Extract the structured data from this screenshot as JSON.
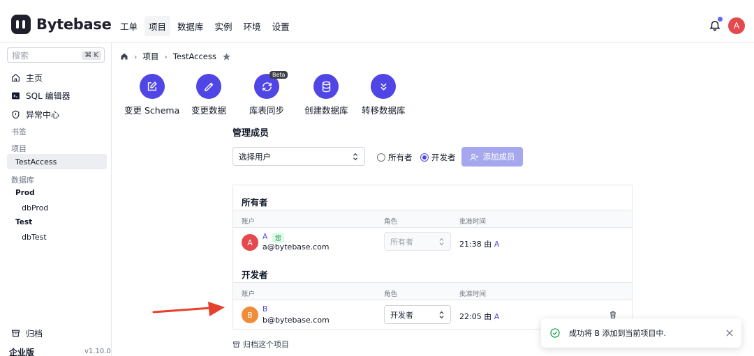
{
  "header": {
    "brand": "Bytebase",
    "nav": [
      "工单",
      "项目",
      "数据库",
      "实例",
      "环境",
      "设置"
    ],
    "active_nav": "项目",
    "user_initial": "A"
  },
  "sidebar": {
    "search_placeholder": "搜索",
    "search_shortcut": "⌘ K",
    "items": [
      {
        "label": "主页",
        "icon": "home-icon"
      },
      {
        "label": "SQL 编辑器",
        "icon": "terminal-icon"
      },
      {
        "label": "异常中心",
        "icon": "shield-icon"
      }
    ],
    "bookmarks_label": "书签",
    "projects_label": "项目",
    "active_project": "TestAccess",
    "databases_label": "数据库",
    "env_groups": [
      {
        "env": "Prod",
        "db": "dbProd"
      },
      {
        "env": "Test",
        "db": "dbTest"
      }
    ],
    "archive_label": "归档",
    "edition": "企业版",
    "version": "v1.10.0"
  },
  "breadcrumb": {
    "project_label": "项目",
    "project_name": "TestAccess"
  },
  "actions": [
    {
      "label": "变更 Schema",
      "icon": "edit-square-icon"
    },
    {
      "label": "变更数据",
      "icon": "pencil-icon"
    },
    {
      "label": "库表同步",
      "icon": "sync-icon",
      "badge": "Beta"
    },
    {
      "label": "创建数据库",
      "icon": "database-icon"
    },
    {
      "label": "转移数据库",
      "icon": "chevrons-down-icon"
    }
  ],
  "members": {
    "title": "管理成员",
    "user_select_placeholder": "选择用户",
    "role_owner": "所有者",
    "role_developer": "开发者",
    "selected_role": "开发者",
    "add_button": "添加成员",
    "groups": [
      {
        "title": "所有者",
        "columns": [
          "账户",
          "角色",
          "批准时间"
        ],
        "rows": [
          {
            "initial": "A",
            "name": "A",
            "you_badge": "您",
            "email": "a@bytebase.com",
            "role": "所有者",
            "approved_time": "21:38 由",
            "approved_by": "A",
            "color": "#e5484d"
          }
        ]
      },
      {
        "title": "开发者",
        "columns": [
          "账户",
          "角色",
          "批准时间"
        ],
        "rows": [
          {
            "initial": "B",
            "name": "B",
            "email": "b@bytebase.com",
            "role": "开发者",
            "approved_time": "22:05 由",
            "approved_by": "A",
            "color": "#f08c3a"
          }
        ]
      }
    ],
    "archive_link": "归档这个项目"
  },
  "toast": {
    "message": "成功将 B 添加到当前项目中."
  },
  "colors": {
    "accent": "#4f46e5",
    "success": "#16a34a"
  }
}
